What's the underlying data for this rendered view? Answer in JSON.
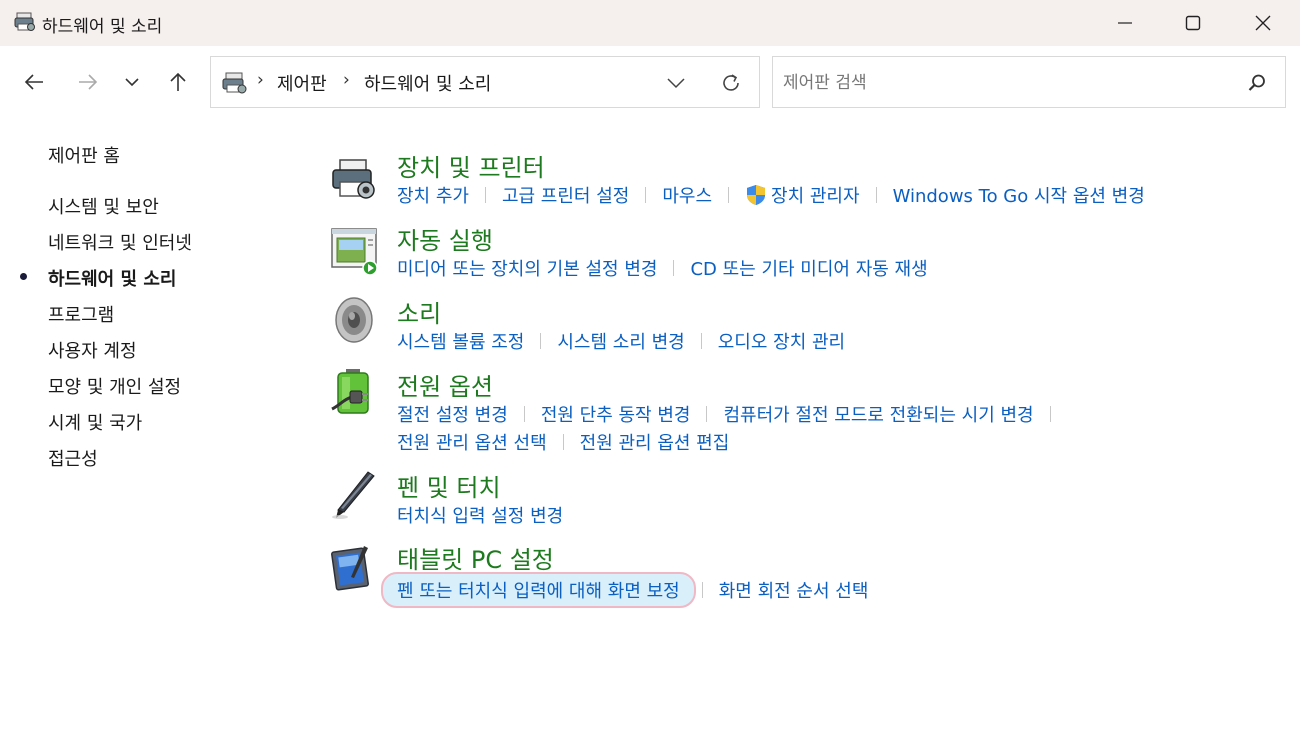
{
  "window": {
    "title": "하드웨어 및 소리",
    "controls": [
      "minimize-icon",
      "maximize-icon",
      "close-icon"
    ]
  },
  "address": {
    "breadcrumbs": [
      "제어판",
      "하드웨어 및 소리"
    ],
    "search_placeholder": "제어판 검색"
  },
  "leftnav": {
    "home": "제어판 홈",
    "items": [
      {
        "label": "시스템 및 보안",
        "active": false
      },
      {
        "label": "네트워크 및 인터넷",
        "active": false
      },
      {
        "label": "하드웨어 및 소리",
        "active": true
      },
      {
        "label": "프로그램",
        "active": false
      },
      {
        "label": "사용자 계정",
        "active": false
      },
      {
        "label": "모양 및 개인 설정",
        "active": false
      },
      {
        "label": "시계 및 국가",
        "active": false
      },
      {
        "label": "접근성",
        "active": false
      }
    ]
  },
  "sections": [
    {
      "title": "장치 및 프린터",
      "icon": "printer-icon",
      "rows": [
        [
          "장치 추가",
          "고급 프린터 설정",
          "마우스",
          "장치 관리자",
          "Windows To Go 시작 옵션 변경"
        ]
      ]
    },
    {
      "title": "자동 실행",
      "icon": "autoplay-icon",
      "rows": [
        [
          "미디어 또는 장치의 기본 설정 변경",
          "CD 또는 기타 미디어 자동 재생"
        ]
      ]
    },
    {
      "title": "소리",
      "icon": "speaker-icon",
      "rows": [
        [
          "시스템 볼륨 조정",
          "시스템 소리 변경",
          "오디오 장치 관리"
        ]
      ]
    },
    {
      "title": "전원 옵션",
      "icon": "battery-icon",
      "rows": [
        [
          "절전 설정 변경",
          "전원 단추 동작 변경",
          "컴퓨터가 절전 모드로 전환되는 시기 변경"
        ],
        [
          "전원 관리 옵션 선택",
          "전원 관리 옵션 편집"
        ]
      ]
    },
    {
      "title": "펜 및 터치",
      "icon": "pen-icon",
      "rows": [
        [
          "터치식 입력 설정 변경"
        ]
      ]
    },
    {
      "title": "태블릿 PC 설정",
      "icon": "tablet-icon",
      "rows": [
        [
          "펜 또는 터치식 입력에 대해 화면 보정",
          "화면 회전 순서 선택"
        ]
      ]
    }
  ],
  "colors": {
    "title_green": "#1e7a1e",
    "link_blue": "#0b5fc1",
    "titlebar_bg": "#f5efed",
    "highlight_bg": "#d9effa"
  }
}
